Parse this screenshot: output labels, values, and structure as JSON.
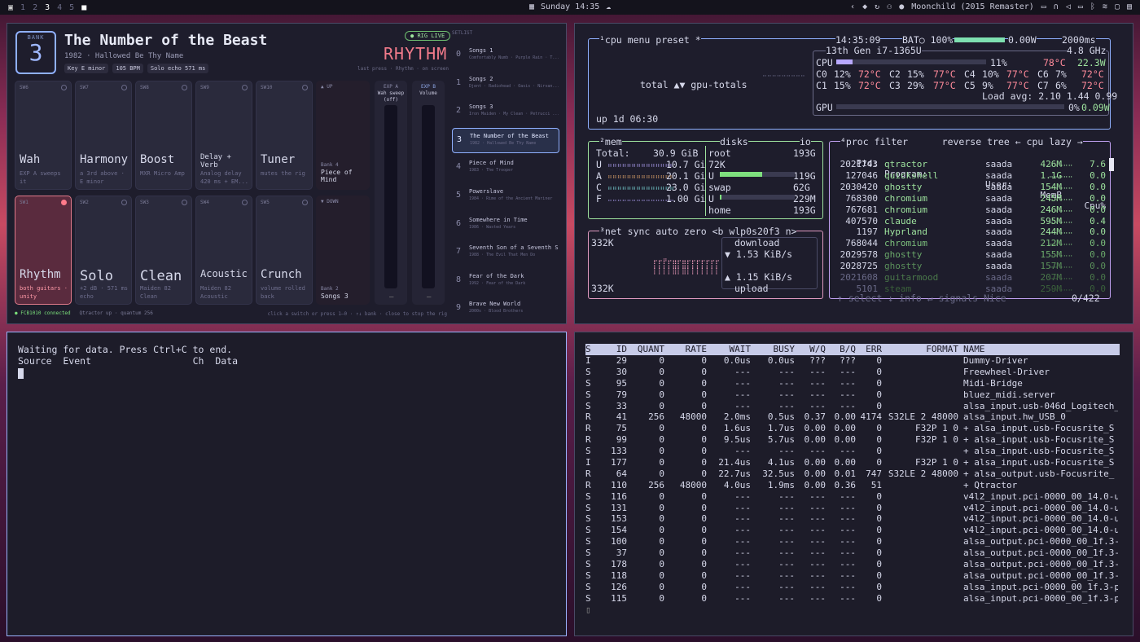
{
  "topbar": {
    "workspaces": [
      "1",
      "2",
      "3",
      "4",
      "5"
    ],
    "active_workspace": "3",
    "clock": "Sunday 14:35",
    "now_playing": "Moonchild (2015 Remaster)"
  },
  "pedal": {
    "bank_label": "BANK",
    "bank_number": "3",
    "song_title": "The Number of the Beast",
    "song_sub": "1982 · Hallowed Be Thy Name",
    "chips": [
      "Key E minor",
      "105 BPM",
      "Solo echo 571 ms"
    ],
    "rig_live": "RIG LIVE",
    "current_preset": "RHYTHM",
    "hint": "last press · Rhythm · on screen",
    "switches_top": [
      {
        "id": "SW6",
        "name": "Wah",
        "desc": "EXP A sweeps it"
      },
      {
        "id": "SW7",
        "name": "Harmony",
        "desc": "a 3rd above · E minor"
      },
      {
        "id": "SW8",
        "name": "Boost",
        "desc": "MXR Micro Amp"
      },
      {
        "id": "SW9",
        "name": "Delay + Verb",
        "desc": "Analog delay 420 ms + EM..."
      },
      {
        "id": "SW10",
        "name": "Tuner",
        "desc": "mutes the rig"
      }
    ],
    "switches_bottom": [
      {
        "id": "SW1",
        "name": "Rhythm",
        "desc": "both guitars · unity"
      },
      {
        "id": "SW2",
        "name": "Solo",
        "desc": "+2 dB · 571 ms echo"
      },
      {
        "id": "SW3",
        "name": "Clean",
        "desc": "Maiden 82 Clean"
      },
      {
        "id": "SW4",
        "name": "Acoustic",
        "desc": "Maiden 82 Acoustic"
      },
      {
        "id": "SW5",
        "name": "Crunch",
        "desc": "volume rolled back"
      }
    ],
    "nav_up": {
      "label": "▲ UP",
      "bank": "Bank 4",
      "song": "Piece of Mind"
    },
    "nav_down": {
      "label": "▼ DOWN",
      "bank": "Bank 2",
      "song": "Songs 3"
    },
    "exp_a": {
      "title": "EXP A",
      "sub": "Wah sweep (off)"
    },
    "exp_b": {
      "title": "EXP B",
      "sub": "Volume"
    },
    "footer_status": "FCB1010 connected",
    "footer_info": "Qtractor up · quantum 256",
    "footer_help": "click a switch or press 1–0 · ↑↓ bank · close to stop the rig",
    "setlist_header": "SETLIST",
    "setlist": [
      {
        "n": "0",
        "title": "Songs 1",
        "sub": "Comfortably Numb · Purple Rain · T..."
      },
      {
        "n": "1",
        "title": "Songs 2",
        "sub": "Djent · Radiohead · Oasis · Nirvan..."
      },
      {
        "n": "2",
        "title": "Songs 3",
        "sub": "Iron Maiden · My Clean · Petrucci ..."
      },
      {
        "n": "3",
        "title": "The Number of the Beast",
        "sub": "1982 · Hallowed Be Thy Name"
      },
      {
        "n": "4",
        "title": "Piece of Mind",
        "sub": "1983 · The Trooper"
      },
      {
        "n": "5",
        "title": "Powerslave",
        "sub": "1984 · Rime of the Ancient Mariner"
      },
      {
        "n": "6",
        "title": "Somewhere in Time",
        "sub": "1986 · Wasted Years"
      },
      {
        "n": "7",
        "title": "Seventh Son of a Seventh S...",
        "sub": "1988 · The Evil That Men Do"
      },
      {
        "n": "8",
        "title": "Fear of the Dark",
        "sub": "1992 · Fear of the Dark"
      },
      {
        "n": "9",
        "title": "Brave New World",
        "sub": "2000s · Blood Brothers"
      }
    ]
  },
  "midi": {
    "line1": "Waiting for data. Press Ctrl+C to end.",
    "line2": "Source  Event                  Ch  Data"
  },
  "btop": {
    "cpu_menu": [
      "¹cpu",
      "menu",
      "preset *"
    ],
    "time": "14:35:09",
    "bat": "BAT○ 100%",
    "bat_watts": "0.00W",
    "interval": "2000ms",
    "cpu_name": "13th Gen i7-1365U",
    "cpu_freq": "4.8 GHz",
    "cpu_total": {
      "label": "CPU",
      "pct": "11%",
      "temp": "78°C",
      "watts": "22.3W"
    },
    "cores": [
      [
        "C0",
        "12%",
        "72°C",
        "C2",
        "15%",
        "77°C",
        "C4",
        "10%",
        "77°C",
        "C6",
        "7%",
        "72°C"
      ],
      [
        "C1",
        "15%",
        "72°C",
        "C3",
        "29%",
        "77°C",
        "C5",
        "9%",
        "77°C",
        "C7",
        "6%",
        "72°C"
      ]
    ],
    "load_avg": "Load avg: 2.10 1.44 0.99",
    "gpu": {
      "label": "GPU",
      "pct": "0%",
      "watts": "0.09W"
    },
    "graph_label": "total ▲▼ gpu-totals",
    "uptime": "up 1d 06:30",
    "mem": {
      "title": "²mem",
      "total_label": "Total:",
      "total": "30.9 GiB",
      "rows": [
        [
          "U",
          "10.7 Gi"
        ],
        [
          "A",
          "20.1 Gi"
        ],
        [
          "C",
          "23.0 Gi"
        ],
        [
          "F",
          "1.00 Gi"
        ]
      ]
    },
    "disks": {
      "title": "disks",
      "io": "io",
      "rows": [
        [
          "root",
          "193G"
        ],
        [
          "72K",
          ""
        ],
        [
          "U",
          "119G"
        ],
        [
          "swap",
          "62G"
        ],
        [
          "U",
          "229M"
        ],
        [
          "home",
          "193G"
        ]
      ]
    },
    "net": {
      "title": "³net",
      "opts": [
        "sync",
        "auto",
        "zero"
      ],
      "iface": "<b wlp0s20f3 n>",
      "top": "332K",
      "bottom": "332K",
      "download_label": "download",
      "download": "▼ 1.53 KiB/s",
      "upload": "▲ 1.15 KiB/s",
      "upload_label": "upload"
    },
    "proc": {
      "title": "⁴proc",
      "filter": "filter",
      "reverse": "reverse",
      "tree": "tree",
      "sort": "← cpu lazy →",
      "headers": [
        "Pid:",
        "Program:",
        "User:",
        "MemB",
        "Cpu%"
      ],
      "rows": [
        [
          "2021743",
          "qtractor",
          "saada",
          "426M",
          "7.6"
        ],
        [
          "127046",
          "quickshell",
          "saada",
          "1.1G",
          "0.0"
        ],
        [
          "2030420",
          "ghostty",
          "saada",
          "154M",
          "0.0"
        ],
        [
          "768300",
          "chromium",
          "saada",
          "245M",
          "0.0"
        ],
        [
          "767681",
          "chromium",
          "saada",
          "246M",
          "0.0"
        ],
        [
          "407570",
          "claude",
          "saada",
          "595M",
          "0.4"
        ],
        [
          "1197",
          "Hyprland",
          "saada",
          "244M",
          "0.0"
        ],
        [
          "768044",
          "chromium",
          "saada",
          "212M",
          "0.0"
        ],
        [
          "2029578",
          "ghostty",
          "saada",
          "155M",
          "0.0"
        ],
        [
          "2028725",
          "ghostty",
          "saada",
          "157M",
          "0.0"
        ],
        [
          "2021608",
          "guitarmood",
          "saada",
          "207M",
          "0.0"
        ],
        [
          "5101",
          "steam",
          "saada",
          "259M",
          "0.0"
        ]
      ],
      "footer": "↑ select ↓ info ↵ signals Nice",
      "count": "0/422"
    }
  },
  "pwtop": {
    "headers": [
      "S",
      "ID",
      "QUANT",
      "RATE",
      "WAIT",
      "BUSY",
      "W/Q",
      "B/Q",
      "ERR",
      "FORMAT",
      "NAME"
    ],
    "rows": [
      [
        "I",
        "29",
        "0",
        "0",
        "0.0us",
        "0.0us",
        "???",
        "???",
        "0",
        "",
        "Dummy-Driver"
      ],
      [
        "S",
        "30",
        "0",
        "0",
        "---",
        "---",
        "---",
        "---",
        "0",
        "",
        "Freewheel-Driver"
      ],
      [
        "S",
        "95",
        "0",
        "0",
        "---",
        "---",
        "---",
        "---",
        "0",
        "",
        "Midi-Bridge"
      ],
      [
        "S",
        "79",
        "0",
        "0",
        "---",
        "---",
        "---",
        "---",
        "0",
        "",
        "bluez_midi.server"
      ],
      [
        "S",
        "33",
        "0",
        "0",
        "---",
        "---",
        "---",
        "---",
        "0",
        "",
        "alsa_input.usb-046d_Logitech_"
      ],
      [
        "R",
        "41",
        "256",
        "48000",
        "2.0ms",
        "0.5us",
        "0.37",
        "0.00",
        "4174",
        "S32LE 2 48000",
        "alsa_input.hw_USB_0"
      ],
      [
        "R",
        "75",
        "0",
        "0",
        "1.6us",
        "1.7us",
        "0.00",
        "0.00",
        "0",
        "F32P 1 0",
        "+ alsa_input.usb-Focusrite_S"
      ],
      [
        "R",
        "99",
        "0",
        "0",
        "9.5us",
        "5.7us",
        "0.00",
        "0.00",
        "0",
        "F32P 1 0",
        "+ alsa_input.usb-Focusrite_S"
      ],
      [
        "S",
        "133",
        "0",
        "0",
        "---",
        "---",
        "---",
        "---",
        "0",
        "",
        "+ alsa_input.usb-Focusrite_S"
      ],
      [
        "I",
        "177",
        "0",
        "0",
        "21.4us",
        "4.1us",
        "0.00",
        "0.00",
        "0",
        "F32P 1 0",
        "+ alsa_input.usb-Focusrite_S"
      ],
      [
        "R",
        "64",
        "0",
        "0",
        "22.7us",
        "32.5us",
        "0.00",
        "0.01",
        "747",
        "S32LE 2 48000",
        "+ alsa_output.usb-Focusrite_"
      ],
      [
        "R",
        "110",
        "256",
        "48000",
        "4.0us",
        "1.9ms",
        "0.00",
        "0.36",
        "51",
        "",
        "+ Qtractor"
      ],
      [
        "S",
        "116",
        "0",
        "0",
        "---",
        "---",
        "---",
        "---",
        "0",
        "",
        "v4l2_input.pci-0000_00_14.0-u"
      ],
      [
        "S",
        "131",
        "0",
        "0",
        "---",
        "---",
        "---",
        "---",
        "0",
        "",
        "v4l2_input.pci-0000_00_14.0-u"
      ],
      [
        "S",
        "153",
        "0",
        "0",
        "---",
        "---",
        "---",
        "---",
        "0",
        "",
        "v4l2_input.pci-0000_00_14.0-u"
      ],
      [
        "S",
        "154",
        "0",
        "0",
        "---",
        "---",
        "---",
        "---",
        "0",
        "",
        "v4l2_input.pci-0000_00_14.0-u"
      ],
      [
        "S",
        "100",
        "0",
        "0",
        "---",
        "---",
        "---",
        "---",
        "0",
        "",
        "alsa_output.pci-0000_00_1f.3-"
      ],
      [
        "S",
        "37",
        "0",
        "0",
        "---",
        "---",
        "---",
        "---",
        "0",
        "",
        "alsa_output.pci-0000_00_1f.3-"
      ],
      [
        "S",
        "178",
        "0",
        "0",
        "---",
        "---",
        "---",
        "---",
        "0",
        "",
        "alsa_output.pci-0000_00_1f.3-"
      ],
      [
        "S",
        "118",
        "0",
        "0",
        "---",
        "---",
        "---",
        "---",
        "0",
        "",
        "alsa_output.pci-0000_00_1f.3-"
      ],
      [
        "S",
        "126",
        "0",
        "0",
        "---",
        "---",
        "---",
        "---",
        "0",
        "",
        "alsa_input.pci-0000_00_1f.3-p"
      ],
      [
        "S",
        "115",
        "0",
        "0",
        "---",
        "---",
        "---",
        "---",
        "0",
        "",
        "alsa_input.pci-0000_00_1f.3-p"
      ]
    ]
  }
}
